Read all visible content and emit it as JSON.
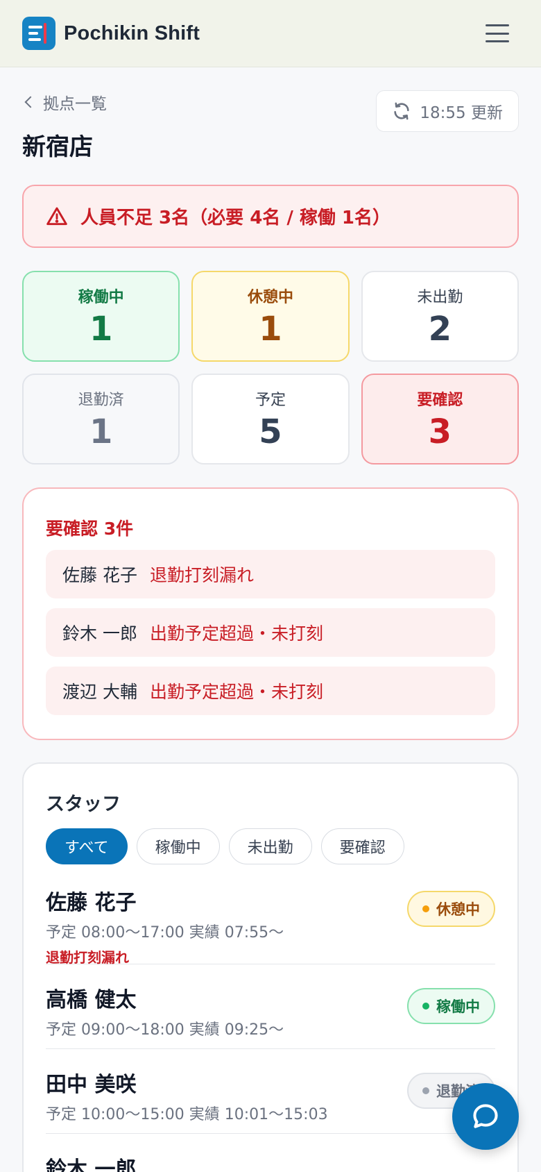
{
  "app": {
    "name": "Pochikin Shift"
  },
  "nav": {
    "back_label": "拠点一覧"
  },
  "page": {
    "title": "新宿店",
    "refresh_label": "18:55 更新"
  },
  "alert": {
    "message": "人員不足 3名（必要 4名 / 稼働 1名）"
  },
  "stats": [
    {
      "label": "稼働中",
      "value": "1"
    },
    {
      "label": "休憩中",
      "value": "1"
    },
    {
      "label": "未出勤",
      "value": "2"
    },
    {
      "label": "退勤済",
      "value": "1"
    },
    {
      "label": "予定",
      "value": "5"
    },
    {
      "label": "要確認",
      "value": "3"
    }
  ],
  "issues": {
    "title": "要確認 3件",
    "items": [
      {
        "name": "佐藤 花子",
        "reason": "退勤打刻漏れ"
      },
      {
        "name": "鈴木 一郎",
        "reason": "出勤予定超過・未打刻"
      },
      {
        "name": "渡辺 大輔",
        "reason": "出勤予定超過・未打刻"
      }
    ]
  },
  "staff": {
    "title": "スタッフ",
    "filters": [
      "すべて",
      "稼働中",
      "未出勤",
      "要確認"
    ],
    "rows": [
      {
        "name": "佐藤 花子",
        "time": "予定 08:00〜17:00  実績 07:55〜",
        "warning": "退勤打刻漏れ",
        "status": "休憩中"
      },
      {
        "name": "高橋 健太",
        "time": "予定 09:00〜18:00  実績 09:25〜",
        "status": "稼働中"
      },
      {
        "name": "田中 美咲",
        "time": "予定 10:00〜15:00  実績 10:01〜15:03",
        "status": "退勤済"
      },
      {
        "name": "鈴木 一郎"
      }
    ]
  },
  "colors": {
    "primary": "#0a74b8",
    "danger": "#c81d25",
    "success": "#127a45",
    "warning": "#9a4c0c"
  },
  "icons": {
    "menu": "hamburger-icon",
    "back": "chevron-left-icon",
    "refresh": "refresh-icon",
    "alert": "warning-triangle-icon",
    "chat": "chat-bubble-icon"
  }
}
